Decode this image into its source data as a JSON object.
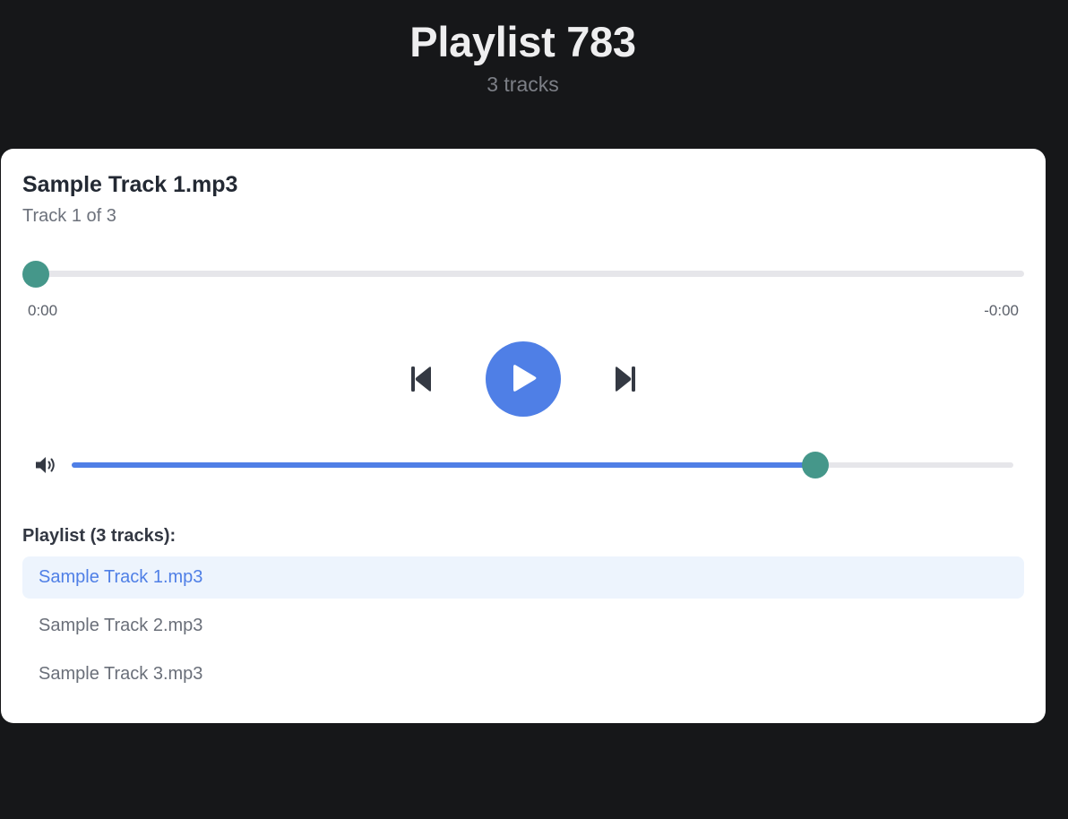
{
  "header": {
    "title": "Playlist 783",
    "subtitle": "3 tracks"
  },
  "player": {
    "track_title": "Sample Track 1.mp3",
    "track_position": "Track 1 of 3",
    "progress_fraction": 0,
    "time_elapsed": "0:00",
    "time_remaining": "-0:00",
    "volume_fraction": 0.79,
    "controls": {
      "previous_icon": "skip-previous-icon",
      "play_icon": "play-icon",
      "next_icon": "skip-next-icon",
      "volume_icon": "speaker-volume-icon"
    }
  },
  "playlist": {
    "heading": "Playlist (3 tracks):",
    "active_index": 0,
    "items": [
      {
        "label": "Sample Track 1.mp3"
      },
      {
        "label": "Sample Track 2.mp3"
      },
      {
        "label": "Sample Track 3.mp3"
      }
    ]
  },
  "colors": {
    "page_background": "#161719",
    "card_background": "#ffffff",
    "accent": "#4f7fe6",
    "thumb": "#45978a",
    "track_background": "#e6e6ea",
    "active_item_background": "#edf4fd",
    "control_icon": "#343943"
  }
}
